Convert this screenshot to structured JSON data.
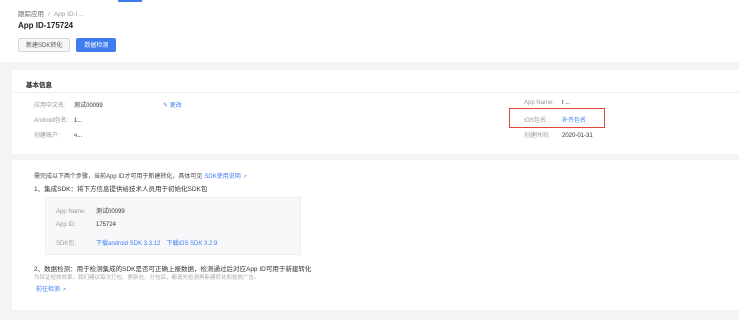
{
  "breadcrumb": {
    "root": "跟踪应用",
    "sep": "/",
    "current": "App ID-l ..."
  },
  "header": {
    "title": "App ID-175724"
  },
  "buttons": {
    "new_sdk": "新建SDK转化",
    "data_check": "数据检测"
  },
  "basic_info": {
    "title": "基本信息",
    "app_cn_name_label": "应用中文名:",
    "app_cn_name_value": "测试00099",
    "edit_label": "更改",
    "android_pkg_label": "Android包名:",
    "android_pkg_value": "1...",
    "creator_label": "创建账户:",
    "creator_value": "ч...",
    "app_name_label": "App Name:",
    "app_name_value": "t ...",
    "ios_pkg_label": "iOS包名:",
    "ios_pkg_action": "补齐包名",
    "created_label": "创建时间:",
    "created_value": "2020-01-31"
  },
  "steps": {
    "intro": "需完成以下两个步骤，当前App ID才可用于新建转化，具体可见",
    "intro_link": "SDK使用说明",
    "step1_title": "1、集成SDK：将下方信息提供给技术人员用于初始化SDK包",
    "sdk_app_name_label": "App Name:",
    "sdk_app_name_value": "测试00099",
    "sdk_app_id_label": "App ID:",
    "sdk_app_id_value": "175724",
    "sdk_pkg_label": "SDK包:",
    "sdk_android_link": "下载android SDK 3.3.12",
    "sdk_ios_link": "下载iOS SDK 3.2.9",
    "step2_title": "2、数据检测：用于检测集成的SDK是否可正确上报数据，检测通过后对应App ID可用于新建转化",
    "step2_sub": "为保证短效效果，我们建议每次打包、更新包、分包后，都请先检测再新建转化和投放广告。",
    "go_check_link": "前往检测"
  }
}
